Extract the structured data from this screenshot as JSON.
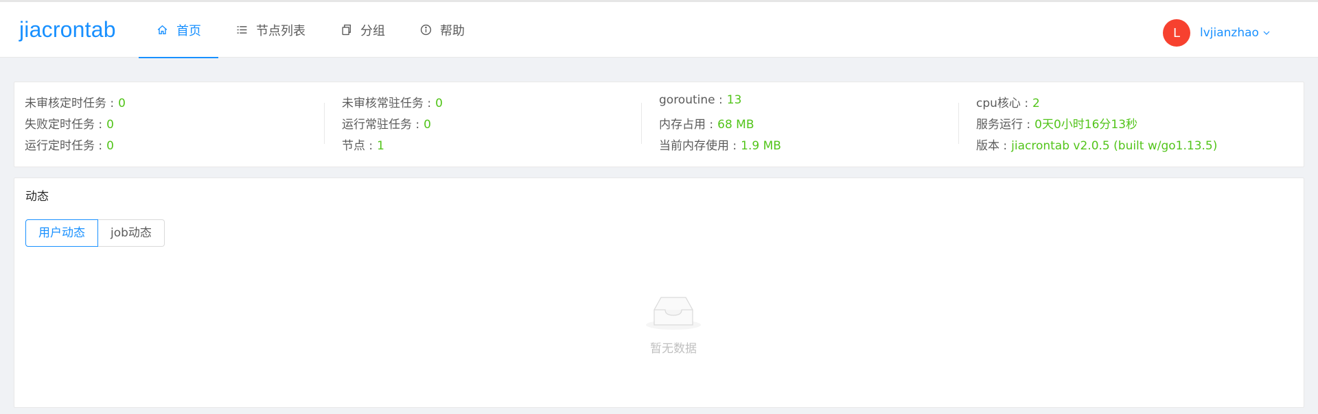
{
  "app": {
    "title": "jiacrontab"
  },
  "nav": {
    "items": [
      {
        "label": "首页",
        "icon": "home-icon",
        "active": true
      },
      {
        "label": "节点列表",
        "icon": "list-icon",
        "active": false
      },
      {
        "label": "分组",
        "icon": "copy-icon",
        "active": false
      },
      {
        "label": "帮助",
        "icon": "info-circle-icon",
        "active": false
      }
    ]
  },
  "user": {
    "initial": "L",
    "name": "lvjianzhao",
    "avatar_color": "#f7412f"
  },
  "stats": {
    "col1": [
      {
        "label": "未审核定时任务 :",
        "value": "0"
      },
      {
        "label": "失败定时任务 :",
        "value": "0"
      },
      {
        "label": "运行定时任务 :",
        "value": "0"
      }
    ],
    "col2": [
      {
        "label": "未审核常驻任务 :",
        "value": "0"
      },
      {
        "label": "运行常驻任务 :",
        "value": "0"
      },
      {
        "label": "节点 :",
        "value": "1"
      }
    ],
    "col3": [
      {
        "label": "goroutine :",
        "value": "13"
      },
      {
        "label": "内存占用 :",
        "value": "68 MB"
      },
      {
        "label": "当前内存使用 :",
        "value": "1.9 MB"
      }
    ],
    "col4": [
      {
        "label": "cpu核心 :",
        "value": "2"
      },
      {
        "label": "服务运行 :",
        "value": "0天0小时16分13秒"
      },
      {
        "label": "版本 :",
        "value": "jiacrontab v2.0.5 (built w/go1.13.5)"
      }
    ]
  },
  "activity": {
    "title": "动态",
    "tabs": [
      {
        "label": "用户动态",
        "active": true
      },
      {
        "label": "job动态",
        "active": false
      }
    ],
    "empty_text": "暂无数据"
  },
  "colors": {
    "accent": "#1890ff",
    "value_green": "#52c41a"
  }
}
